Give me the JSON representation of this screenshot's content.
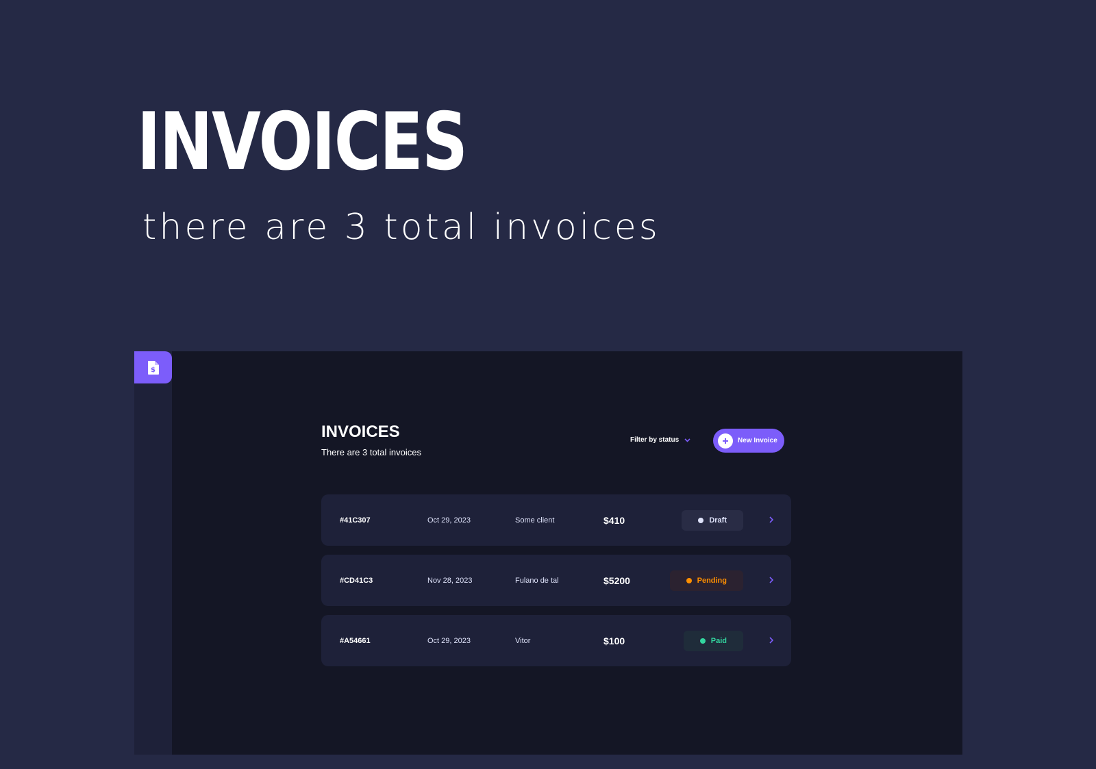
{
  "hero": {
    "title": "INVOICES",
    "subtitle": "there are 3 total invoices"
  },
  "app": {
    "logo_icon": "invoice-dollar-icon",
    "accent_color": "#7c5dfa",
    "title": "INVOICES",
    "subtitle": "There are 3 total invoices",
    "filter_label": "Filter by status",
    "new_invoice_label": "New Invoice",
    "invoices": [
      {
        "id": "#41C307",
        "date": "Oct 29, 2023",
        "client": "Some client",
        "amount": "$410",
        "status": "Draft",
        "status_color": "#dfe3fa",
        "status_bg": "#292c45"
      },
      {
        "id": "#CD41C3",
        "date": "Nov 28, 2023",
        "client": "Fulano de tal",
        "amount": "$5200",
        "status": "Pending",
        "status_color": "#ff8f00",
        "status_bg": "#2b2230"
      },
      {
        "id": "#A54661",
        "date": "Oct 29, 2023",
        "client": "Vitor",
        "amount": "$100",
        "status": "Paid",
        "status_color": "#33d69f",
        "status_bg": "#1f2c3a"
      }
    ]
  }
}
